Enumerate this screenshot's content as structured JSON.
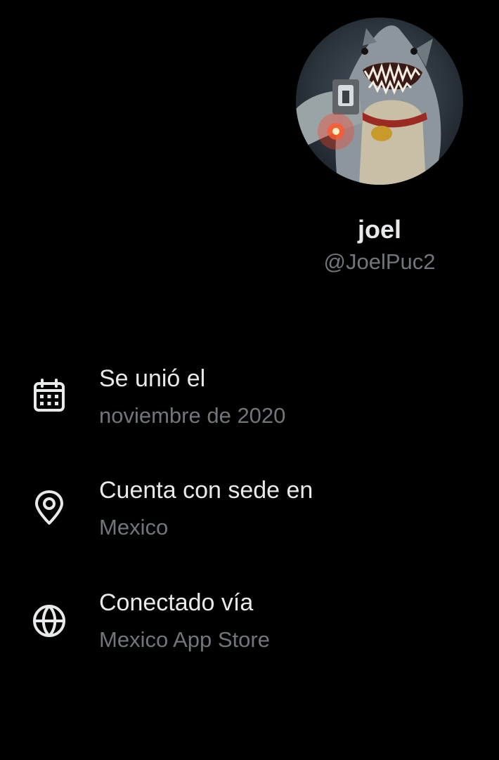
{
  "profile": {
    "name": "joel",
    "handle": "@JoelPuc2"
  },
  "about": {
    "joined": {
      "label": "Se unió el",
      "value": "noviembre de 2020",
      "icon": "calendar-icon"
    },
    "based_in": {
      "label": "Cuenta con sede en",
      "value": "Mexico",
      "icon": "location-pin-icon"
    },
    "connected_via": {
      "label": "Conectado vía",
      "value": "Mexico App Store",
      "icon": "globe-icon"
    }
  },
  "colors": {
    "background": "#000000",
    "primary_text": "#e7e9ea",
    "secondary_text": "#71767b"
  }
}
